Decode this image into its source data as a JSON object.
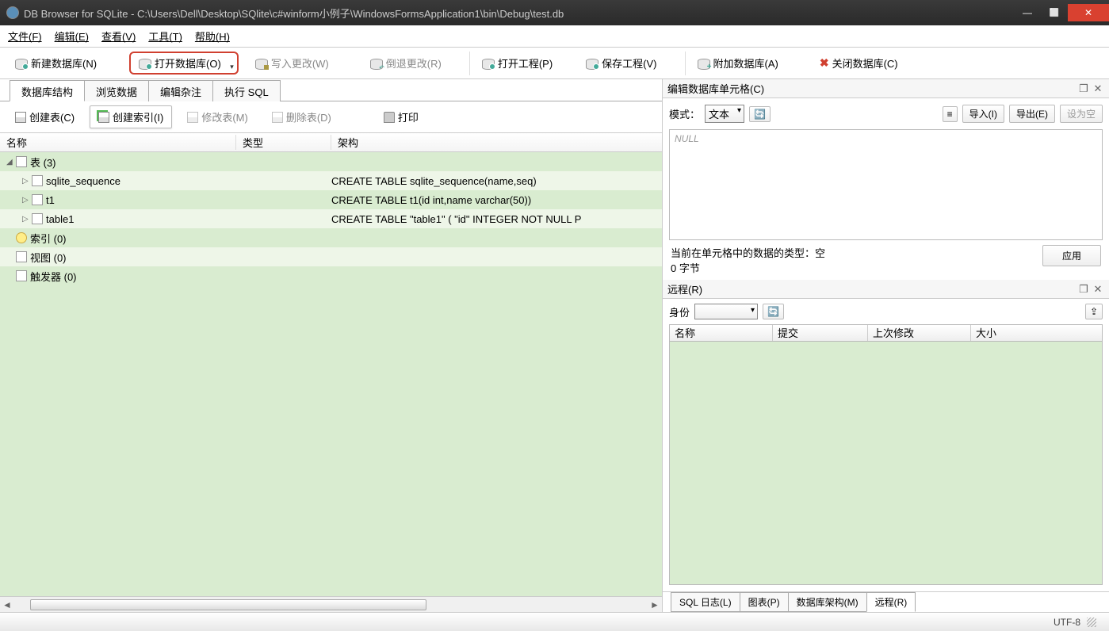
{
  "title": "DB Browser for SQLite - C:\\Users\\Dell\\Desktop\\SQlite\\c#winform小例子\\WindowsFormsApplication1\\bin\\Debug\\test.db",
  "menu": {
    "file": "文件(F)",
    "edit": "编辑(E)",
    "view": "查看(V)",
    "tool": "工具(T)",
    "help": "帮助(H)"
  },
  "toolbar": {
    "new_db": "新建数据库(N)",
    "open_db": "打开数据库(O)",
    "write_changes": "写入更改(W)",
    "revert_changes": "倒退更改(R)",
    "open_project": "打开工程(P)",
    "save_project": "保存工程(V)",
    "attach_db": "附加数据库(A)",
    "close_db": "关闭数据库(C)"
  },
  "main_tabs": {
    "structure": "数据库结构",
    "browse": "浏览数据",
    "pragma": "编辑杂注",
    "sql": "执行 SQL"
  },
  "struct_toolbar": {
    "create_table": "创建表(C)",
    "create_index": "创建索引(I)",
    "modify_table": "修改表(M)",
    "delete_table": "删除表(D)",
    "print": "打印"
  },
  "tree_header": {
    "name": "名称",
    "type": "类型",
    "schema": "架构"
  },
  "tree": {
    "tables_label": "表 (3)",
    "tables": [
      {
        "name": "sqlite_sequence",
        "schema": "CREATE TABLE sqlite_sequence(name,seq)"
      },
      {
        "name": "t1",
        "schema": "CREATE TABLE t1(id int,name varchar(50))"
      },
      {
        "name": "table1",
        "schema": "CREATE TABLE \"table1\" ( \"id\" INTEGER NOT NULL P"
      }
    ],
    "indexes": "索引 (0)",
    "views": "视图 (0)",
    "triggers": "触发器 (0)"
  },
  "cell_panel": {
    "title": "编辑数据库单元格(C)",
    "mode_label": "模式：",
    "mode_value": "文本",
    "import": "导入(I)",
    "export": "导出(E)",
    "set_null": "设为空",
    "null_text": "NULL",
    "type_info": "当前在单元格中的数据的类型：空",
    "size_info": "0 字节",
    "apply": "应用"
  },
  "remote_panel": {
    "title": "远程(R)",
    "identity_label": "身份",
    "col_name": "名称",
    "col_commit": "提交",
    "col_modified": "上次修改",
    "col_size": "大小"
  },
  "bottom_tabs": {
    "log": "SQL 日志(L)",
    "chart": "图表(P)",
    "schema": "数据库架构(M)",
    "remote": "远程(R)"
  },
  "status": {
    "encoding": "UTF-8"
  }
}
